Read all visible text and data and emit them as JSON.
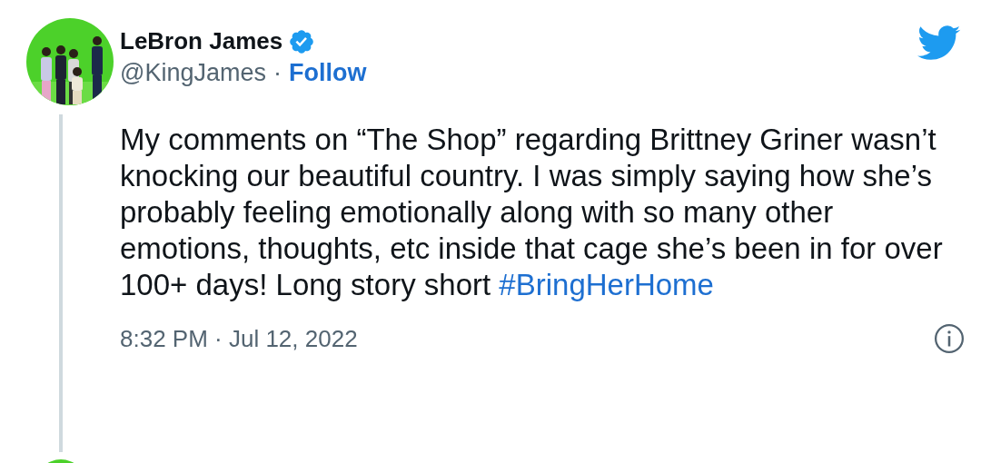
{
  "author": {
    "name": "LeBron James",
    "verified": true,
    "handle": "@KingJames",
    "separator": "·",
    "follow": "Follow"
  },
  "body": {
    "text": "My comments on “The Shop” regarding Brittney Griner wasn’t knocking our beautiful country. I was simply saying how she’s probably feeling emotionally along with so many other emotions, thoughts, etc inside that cage she’s been in for over 100+ days! Long story short",
    "hashtag": "#BringHerHome"
  },
  "timestamp": "8:32 PM · Jul 12, 2022"
}
